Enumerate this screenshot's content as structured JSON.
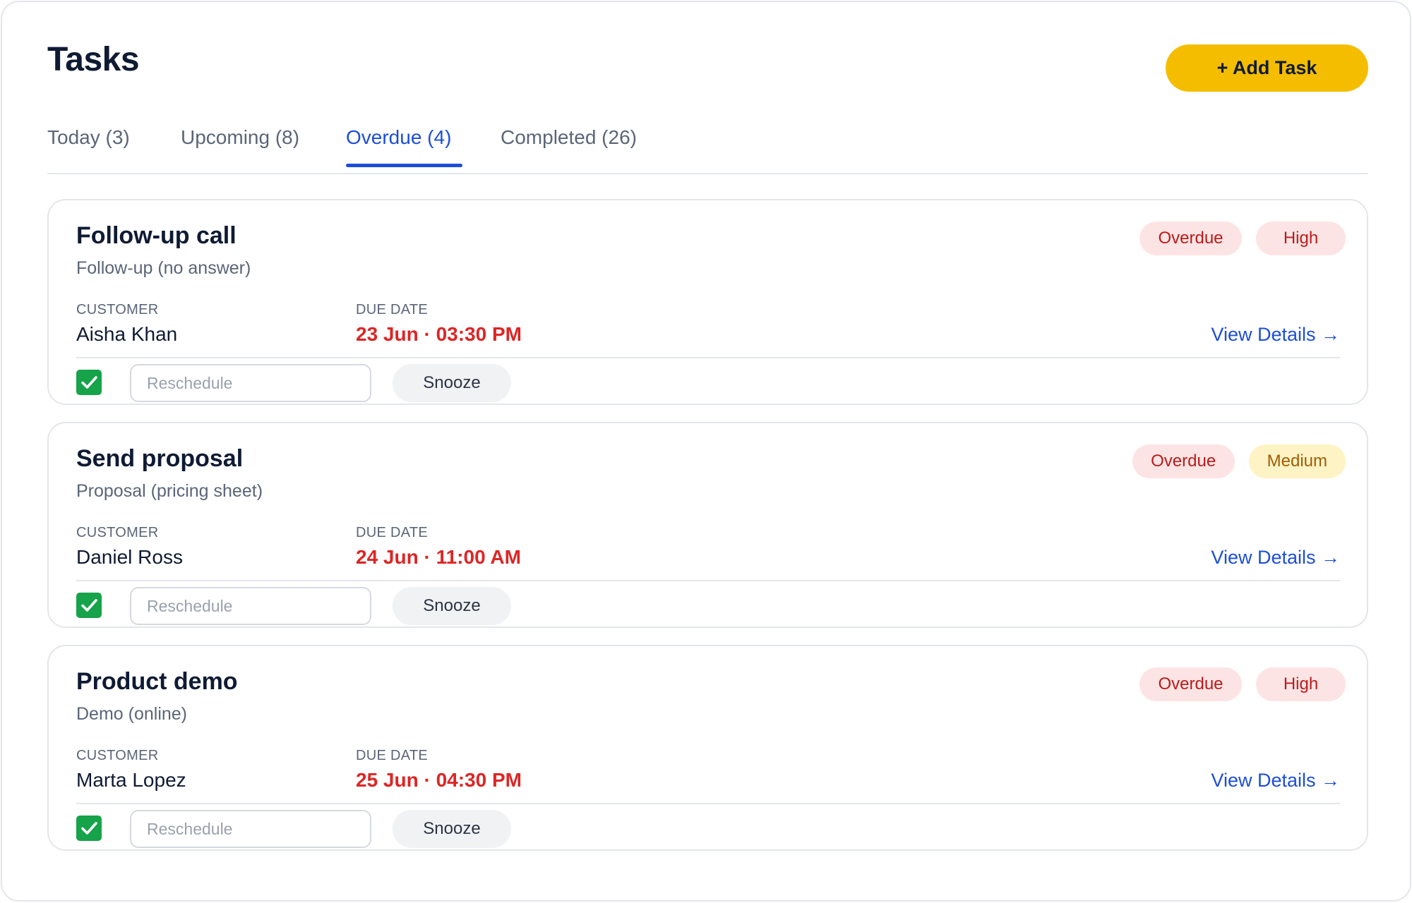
{
  "page": {
    "title": "Tasks",
    "add_button_label": "+ Add Task"
  },
  "tabs": [
    {
      "label": "Today (3)",
      "active": false
    },
    {
      "label": "Upcoming (8)",
      "active": false
    },
    {
      "label": "Overdue (4)",
      "active": true
    },
    {
      "label": "Completed (26)",
      "active": false
    }
  ],
  "labels": {
    "customer": "CUSTOMER",
    "due_date": "DUE DATE",
    "view_details": "View Details →",
    "reschedule_placeholder": "Reschedule",
    "snooze": "Snooze"
  },
  "tasks": [
    {
      "title": "Follow-up call",
      "subtitle": "Follow-up (no answer)",
      "status": "Overdue",
      "priority": "High",
      "customer": "Aisha Khan",
      "due": "23 Jun · 03:30 PM",
      "done": true
    },
    {
      "title": "Send proposal",
      "subtitle": "Proposal (pricing sheet)",
      "status": "Overdue",
      "priority": "Medium",
      "customer": "Daniel Ross",
      "due": "24 Jun · 11:00 AM",
      "done": true
    },
    {
      "title": "Product demo",
      "subtitle": "Demo (online)",
      "status": "Overdue",
      "priority": "High",
      "customer": "Marta Lopez",
      "due": "25 Jun · 04:30 PM",
      "done": true
    }
  ],
  "colors": {
    "accent": "#1d4ed8",
    "add_button": "#f5bd00",
    "overdue_text": "#b91c1c",
    "overdue_bg": "#fde4e4",
    "medium_text": "#a15c07",
    "medium_bg": "#fdf3c4",
    "due_text": "#dc2626",
    "check": "#16a34a"
  }
}
